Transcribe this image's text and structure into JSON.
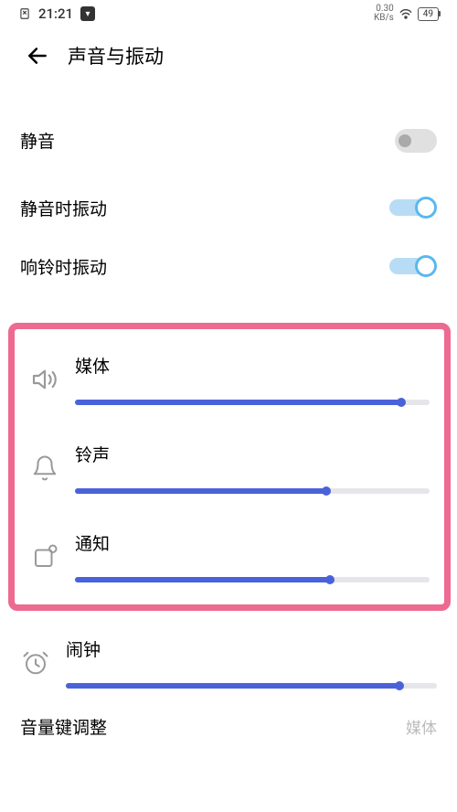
{
  "status_bar": {
    "time": "21:21",
    "net_speed_top": "0.30",
    "net_speed_bottom": "KB/s",
    "battery_text": "49"
  },
  "header": {
    "title": "声音与振动"
  },
  "toggles": {
    "silent": {
      "label": "静音",
      "on": false
    },
    "vibrate_silent": {
      "label": "静音时振动",
      "on": true
    },
    "vibrate_ring": {
      "label": "响铃时振动",
      "on": true
    }
  },
  "volumes": {
    "media": {
      "label": "媒体",
      "percent": 92
    },
    "ringtone": {
      "label": "铃声",
      "percent": 71
    },
    "notification": {
      "label": "通知",
      "percent": 72
    },
    "alarm": {
      "label": "闹钟",
      "percent": 90
    }
  },
  "volume_key": {
    "label": "音量键调整",
    "value": "媒体"
  },
  "colors": {
    "highlight_border": "#ed6a91",
    "slider_fill": "#4a62d9",
    "toggle_on_ring": "#5bb8ef"
  }
}
